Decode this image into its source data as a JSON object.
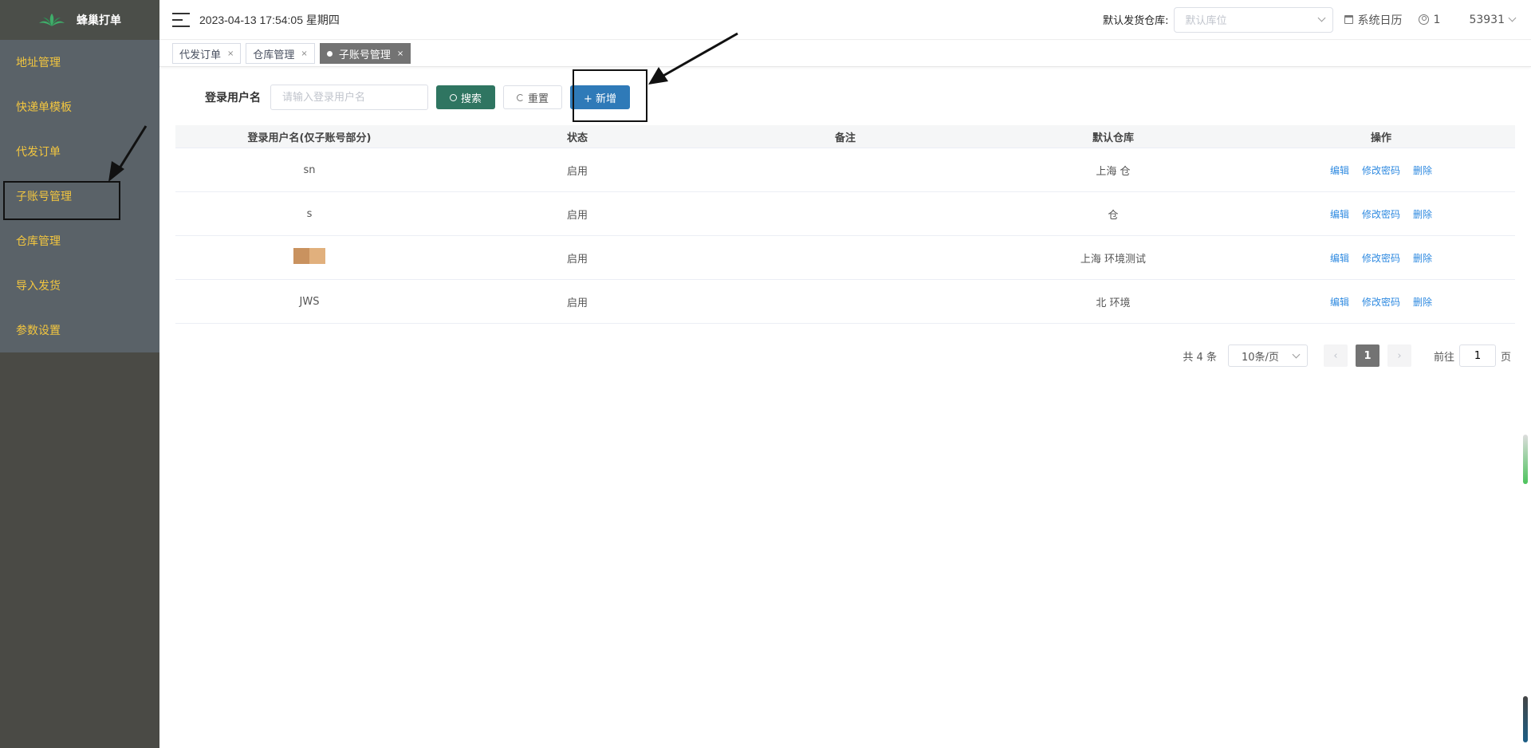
{
  "brand": {
    "name": "蜂巢打单",
    "logo_icon": "leaf-logo-icon"
  },
  "sidebar": {
    "items": [
      {
        "label": "地址管理"
      },
      {
        "label": "快递单模板"
      },
      {
        "label": "代发订单"
      },
      {
        "label": "子账号管理"
      },
      {
        "label": "仓库管理"
      },
      {
        "label": "导入发货"
      },
      {
        "label": "参数设置"
      }
    ],
    "active": "子账号管理",
    "accent_color": "#f3c63f"
  },
  "header": {
    "datetime": "2023-04-13 17:54:05 星期四",
    "warehouse_label": "默认发货仓库:",
    "warehouse_placeholder": "默认库位",
    "calendar_label": "系统日历",
    "user_count": "1",
    "account": "53931"
  },
  "tabs": [
    {
      "label": "代发订单",
      "close": "×"
    },
    {
      "label": "仓库管理",
      "close": "×"
    },
    {
      "label": "子账号管理",
      "close": "×",
      "active": true
    }
  ],
  "search": {
    "label": "登录用户名",
    "placeholder": "请输入登录用户名",
    "search_btn": "搜索",
    "reset_btn": "重置",
    "add_btn": "+ 新增"
  },
  "table": {
    "headers": [
      "登录用户名(仅子账号部分)",
      "状态",
      "备注",
      "默认仓库",
      "操作"
    ],
    "rows": [
      {
        "username": "sn",
        "status": "启用",
        "remark": "",
        "warehouse": "上海 仓"
      },
      {
        "username": "s",
        "status": "启用",
        "remark": "",
        "warehouse": "仓"
      },
      {
        "username": "",
        "status": "启用",
        "remark": "",
        "warehouse": "上海 环境测试"
      },
      {
        "username": "JWS",
        "status": "启用",
        "remark": "",
        "warehouse": "北 环境"
      }
    ],
    "actions": [
      "编辑",
      "修改密码",
      "删除"
    ]
  },
  "pagination": {
    "total": "共 4 条",
    "page_size": "10条/页",
    "prev": "‹",
    "next": "›",
    "current": "1",
    "goto_label": "前往",
    "goto_value": "1",
    "page_suffix": "页"
  }
}
